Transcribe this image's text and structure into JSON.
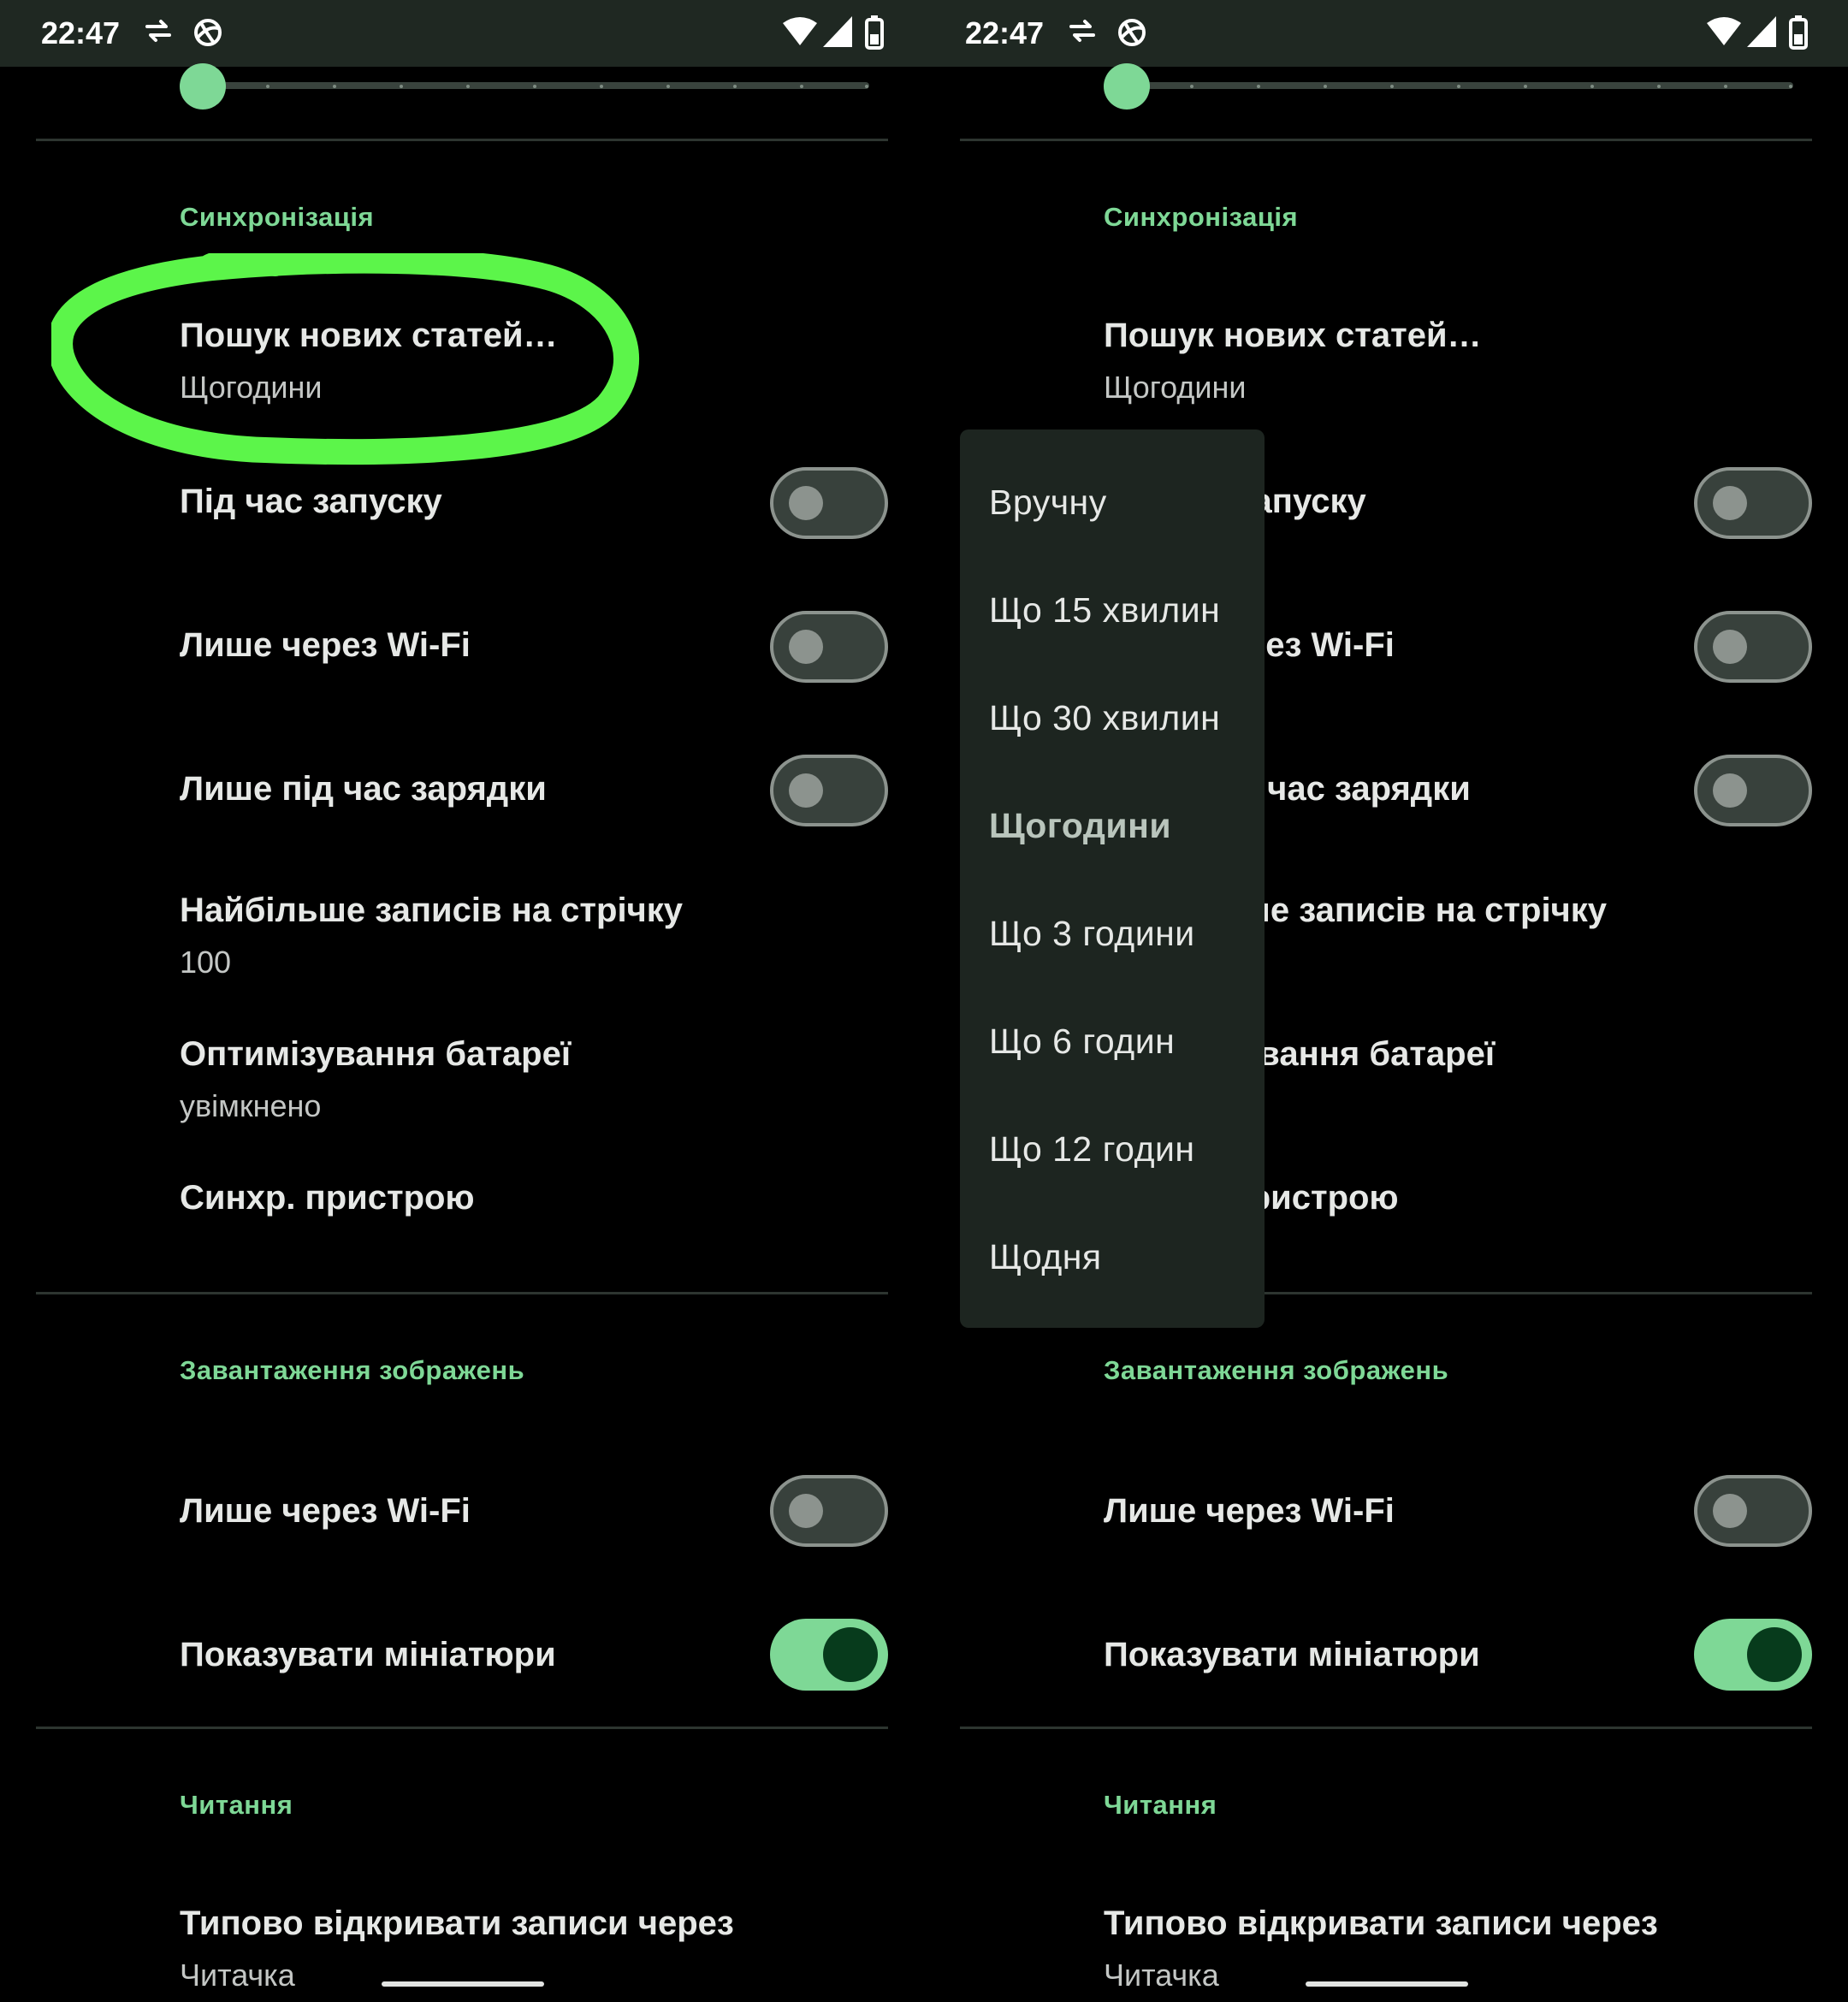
{
  "status_bar": {
    "time": "22:47"
  },
  "sync_section": {
    "title": "Синхронізація",
    "check_new_title": "Пошук нових статей…",
    "check_new_value": "Щогодини",
    "on_launch": "Під час запуску",
    "wifi_only": "Лише через Wi-Fi",
    "charging_only": "Лише під час зарядки",
    "max_items_title": "Найбільше записів на стрічку",
    "max_items_value": "100",
    "battery_title": "Оптимізування батареї",
    "battery_value": "увімкнено",
    "device_sync": "Синхр. пристрою"
  },
  "images_section": {
    "title": "Завантаження зображень",
    "wifi_only": "Лише через Wi-Fi",
    "show_thumbnails": "Показувати мініатюри"
  },
  "reading_section": {
    "title": "Читання",
    "open_with_title": "Типово відкривати записи через",
    "open_with_value": "Читачка"
  },
  "switches": {
    "sync_on_launch": false,
    "sync_wifi_only": false,
    "sync_charging_only": false,
    "images_wifi_only": false,
    "show_thumbnails": true
  },
  "dropdown": {
    "items": [
      "Вручну",
      "Що 15 хвилин",
      "Що 30 хвилин",
      "Щогодини",
      "Що 3 години",
      "Що 6 годин",
      "Що 12 годин",
      "Щодня"
    ],
    "selected": "Щогодини"
  },
  "colors": {
    "accent": "#7ed896",
    "background": "#000000",
    "status_bar": "#1f2822",
    "dropdown_bg": "#1d2520",
    "annotation_highlight": "#5cf54a",
    "switch_on_knob": "#073b1c"
  }
}
